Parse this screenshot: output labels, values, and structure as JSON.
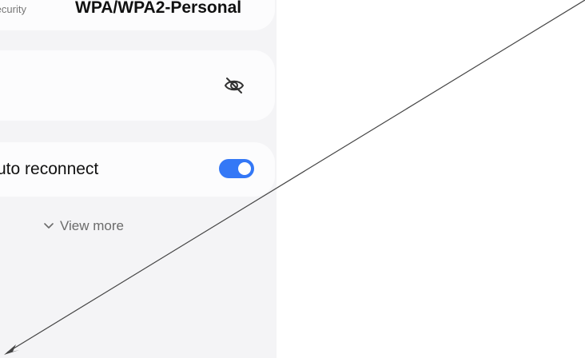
{
  "security": {
    "label": "Security",
    "value": "WPA/WPA2-Personal"
  },
  "password": {
    "visibility_icon": "eye-off-icon"
  },
  "auto_reconnect": {
    "label": "Auto reconnect",
    "enabled": true,
    "toggle_color": "#3478f6"
  },
  "view_more": {
    "label": "View more",
    "icon": "chevron-down-icon"
  },
  "annotation": {
    "type": "arrow",
    "color": "#444444"
  }
}
